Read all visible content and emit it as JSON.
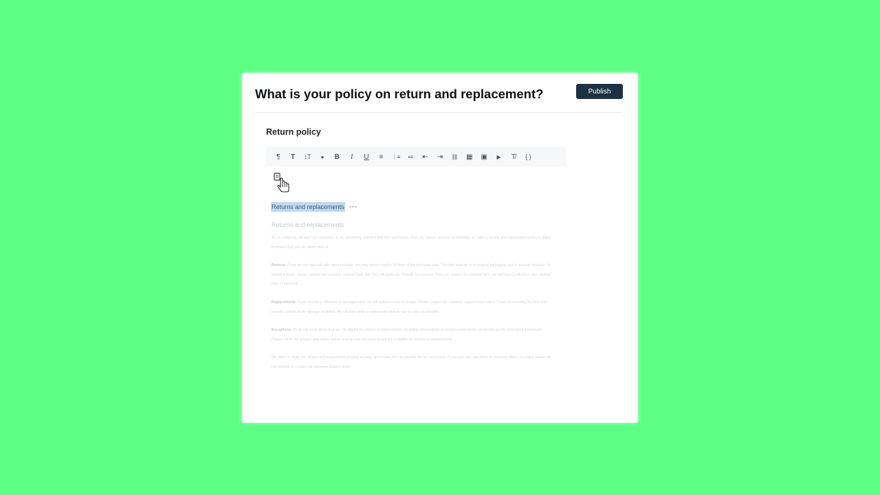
{
  "page": {
    "background": "#5cff84"
  },
  "header": {
    "title": "What is your policy on return and replacement?",
    "publish_label": "Publish"
  },
  "editor": {
    "section_label": "Return policy",
    "toolbar": [
      {
        "icon": "paragraph-icon",
        "glyph": "¶"
      },
      {
        "icon": "text-format-icon",
        "glyph": "T"
      },
      {
        "icon": "text-size-icon",
        "glyph": "↕T"
      },
      {
        "icon": "text-color-icon",
        "glyph": "●"
      },
      {
        "icon": "bold-icon",
        "glyph": "B"
      },
      {
        "icon": "italic-icon",
        "glyph": "I"
      },
      {
        "icon": "underline-icon",
        "glyph": "U"
      },
      {
        "icon": "align-left-icon",
        "glyph": "≡"
      },
      {
        "icon": "ordered-list-icon",
        "glyph": "⋮≡"
      },
      {
        "icon": "bullet-list-icon",
        "glyph": "•≡"
      },
      {
        "icon": "outdent-icon",
        "glyph": "⇤"
      },
      {
        "icon": "indent-icon",
        "glyph": "⇥"
      },
      {
        "icon": "link-icon",
        "glyph": "⛓"
      },
      {
        "icon": "table-icon",
        "glyph": "▦"
      },
      {
        "icon": "image-icon",
        "glyph": "▣"
      },
      {
        "icon": "video-icon",
        "glyph": "▶"
      },
      {
        "icon": "clear-format-icon",
        "glyph": "T̸"
      },
      {
        "icon": "code-icon",
        "glyph": "{ }"
      }
    ],
    "selected_heading": "Returns and replacements",
    "ghost_title": "Returns and replacements",
    "paragraphs": [
      {
        "lead": "",
        "text": "At our company, we want our customers to be completely satisfied with their purchases. If for any reason you are not satisfied, we have a returns and replacement policy in place to ensure that you are taken care of."
      },
      {
        "lead": "Returns:",
        "text": "If you are not satisfied with your purchase, you may return it within 30 days of the purchase date. The item must be in its original packaging and in unused condition. To initiate a return, please contact our customer support team and they will guide you through the process. Once we receive the returned item, we will issue a refund to your original form of payment."
      },
      {
        "lead": "Replacements:",
        "text": "If you receive a defective or damaged item, we will replace it free of charge. Please contact our customer support team within 7 days of receiving the item and provide a photo of the damage or defect. We will then send a replacement item to you as soon as possible."
      },
      {
        "lead": "Exceptions:",
        "text": "There are some items that are not eligible for returns or replacements, including personalized or custom-made items, perishable goods, and digital downloads. Please check the product description before buying your purchase to see if it is eligible for returns or replacements."
      },
      {
        "lead": "",
        "text": "We strive to make the returns and replacement process as easy and hassle-free as possible for our customers. If you have any questions or concerns about our policy, please do not hesitate to contact our customer support team."
      }
    ]
  }
}
